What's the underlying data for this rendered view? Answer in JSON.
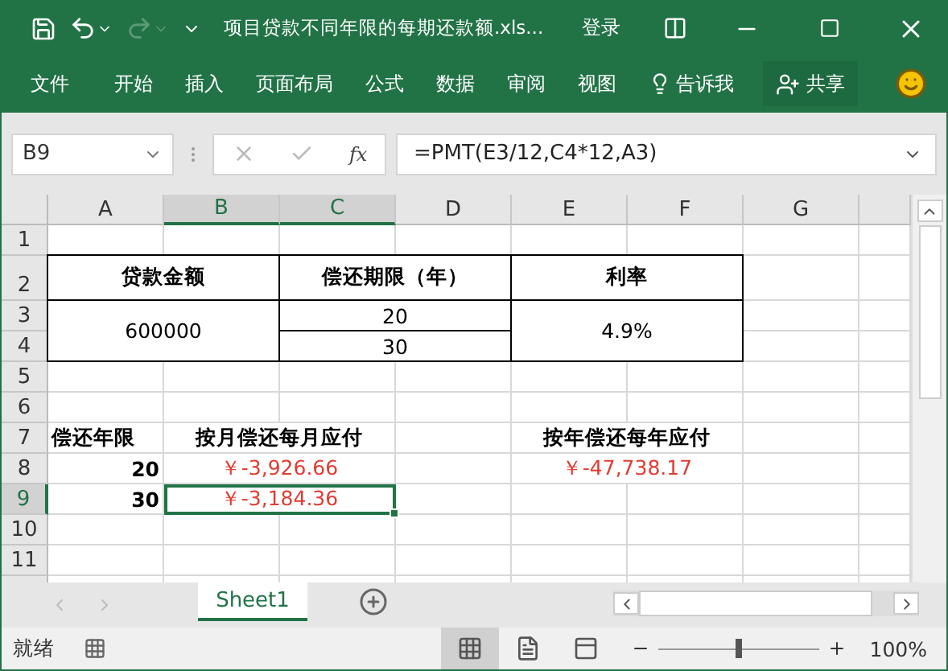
{
  "title_bar": {
    "title": "项目贷款不同年限的每期还款额.xls...",
    "sign_in": "登录",
    "redo_disabled": true
  },
  "ribbon_tabs": [
    {
      "label": "文件"
    },
    {
      "label": "开始"
    },
    {
      "label": "插入"
    },
    {
      "label": "页面布局"
    },
    {
      "label": "公式"
    },
    {
      "label": "数据"
    },
    {
      "label": "审阅"
    },
    {
      "label": "视图"
    }
  ],
  "tell_me": "告诉我",
  "share": "共享",
  "formula_bar": {
    "name_box": "B9",
    "function_label": "fx",
    "formula": "=PMT(E3/12,C4*12,A3)"
  },
  "columns": [
    {
      "label": "A",
      "selected": false
    },
    {
      "label": "B",
      "selected": true
    },
    {
      "label": "C",
      "selected": true
    },
    {
      "label": "D",
      "selected": false
    },
    {
      "label": "E",
      "selected": false
    },
    {
      "label": "F",
      "selected": false
    },
    {
      "label": "G",
      "selected": false
    }
  ],
  "rows": [
    {
      "label": "1",
      "selected": false
    },
    {
      "label": "2",
      "selected": false
    },
    {
      "label": "3",
      "selected": false
    },
    {
      "label": "4",
      "selected": false
    },
    {
      "label": "5",
      "selected": false
    },
    {
      "label": "6",
      "selected": false
    },
    {
      "label": "7",
      "selected": false
    },
    {
      "label": "8",
      "selected": false
    },
    {
      "label": "9",
      "selected": true
    },
    {
      "label": "10",
      "selected": false
    },
    {
      "label": "11",
      "selected": false
    }
  ],
  "cells": [
    {
      "value": "贷款金额",
      "bold": true,
      "bordered": true,
      "selected": false
    },
    {
      "value": "偿还期限（年）",
      "bold": true,
      "bordered": true,
      "selected": false
    },
    {
      "value": "利率",
      "bold": true,
      "bordered": true,
      "selected": false
    },
    {
      "value": "600000",
      "bold": false,
      "bordered": true,
      "selected": false
    },
    {
      "value": "20",
      "bold": false,
      "bordered": true,
      "selected": false
    },
    {
      "value": "30",
      "bold": false,
      "bordered": true,
      "selected": false
    },
    {
      "value": "4.9%",
      "bold": false,
      "bordered": true,
      "selected": false
    },
    {
      "value": "偿还年限",
      "bold": true,
      "bordered": false,
      "selected": false
    },
    {
      "value": "按月偿还每月应付",
      "bold": true,
      "bordered": false,
      "selected": false
    },
    {
      "value": "按年偿还每年应付",
      "bold": true,
      "bordered": false,
      "selected": false
    },
    {
      "value": "20",
      "bold": true,
      "bordered": false,
      "selected": false
    },
    {
      "value": "￥-3,926.66",
      "bold": false,
      "bordered": false,
      "selected": false,
      "color": "#e03c31"
    },
    {
      "value": "￥-47,738.17",
      "bold": false,
      "bordered": false,
      "selected": false,
      "color": "#e03c31"
    },
    {
      "value": "30",
      "bold": true,
      "bordered": false,
      "selected": false
    },
    {
      "value": "￥-3,184.36",
      "bold": false,
      "bordered": false,
      "selected": true,
      "color": "#e03c31"
    }
  ],
  "sheet_tabs": [
    {
      "label": "Sheet1",
      "selected": true
    }
  ],
  "status_bar": {
    "text": "就绪",
    "views": [
      {
        "kind": "normal",
        "selected": true
      },
      {
        "kind": "page_layout",
        "selected": false
      },
      {
        "kind": "page_break",
        "selected": false
      }
    ],
    "zoom": {
      "level": 0.5,
      "reading": "100%"
    }
  }
}
